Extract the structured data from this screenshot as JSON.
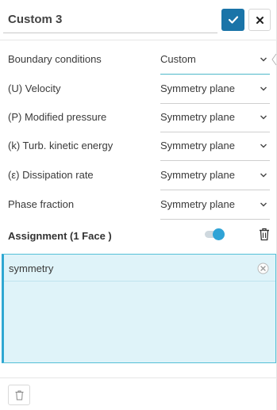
{
  "header": {
    "title_value": "Custom 3",
    "confirm_icon": "check-icon",
    "close_icon": "close-icon"
  },
  "fields": [
    {
      "label": "Boundary conditions",
      "value": "Custom"
    },
    {
      "label": "(U) Velocity",
      "value": "Symmetry plane"
    },
    {
      "label": "(P) Modified pressure",
      "value": "Symmetry plane"
    },
    {
      "label": "(k) Turb. kinetic energy",
      "value": "Symmetry plane"
    },
    {
      "label": "(ε) Dissipation rate",
      "value": "Symmetry plane"
    },
    {
      "label": "Phase fraction",
      "value": "Symmetry plane"
    }
  ],
  "assignment": {
    "title": "Assignment (1 Face )",
    "toggle_on": true,
    "items": [
      {
        "label": "symmetry"
      }
    ]
  },
  "colors": {
    "accent": "#1a74a8",
    "toggle": "#2fa3d6",
    "selection_bg": "#dff3f9",
    "selection_border": "#54bfd7"
  }
}
